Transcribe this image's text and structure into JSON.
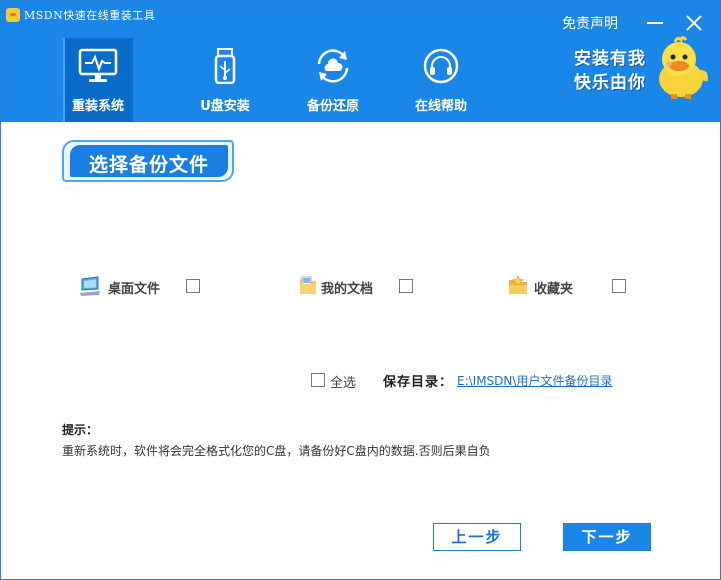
{
  "window": {
    "title": "MSDN快速在线重装工具",
    "disclaimer": "免责声明"
  },
  "nav": {
    "items": [
      {
        "label": "重装系统",
        "icon": "monitor-pulse-icon",
        "active": true
      },
      {
        "label": "U盘安装",
        "icon": "usb-drive-icon",
        "active": false
      },
      {
        "label": "备份还原",
        "icon": "cloud-sync-icon",
        "active": false
      },
      {
        "label": "在线帮助",
        "icon": "headset-icon",
        "active": false
      }
    ]
  },
  "slogan": {
    "line1": "安装有我",
    "line2": "快乐由你"
  },
  "section": {
    "title": "选择备份文件"
  },
  "options": [
    {
      "label": "桌面文件",
      "icon": "desktop-computer-icon",
      "checked": false
    },
    {
      "label": "我的文档",
      "icon": "document-folder-icon",
      "checked": false
    },
    {
      "label": "收藏夹",
      "icon": "favorites-folder-icon",
      "checked": false
    }
  ],
  "select_all": {
    "label": "全选",
    "checked": false
  },
  "save_dir": {
    "label": "保存目录：",
    "path": "E:\\IMSDN\\用户文件备份目录"
  },
  "tips": {
    "title": "提示：",
    "text": "重新系统时，软件将会完全格式化您的C盘，请备份好C盘内的数据.否则后果自负"
  },
  "buttons": {
    "prev": "上一步",
    "next": "下一步"
  },
  "colors": {
    "header": "#1a86e8",
    "active_tab": "#0a6cc9",
    "link": "#1a6fd6"
  }
}
